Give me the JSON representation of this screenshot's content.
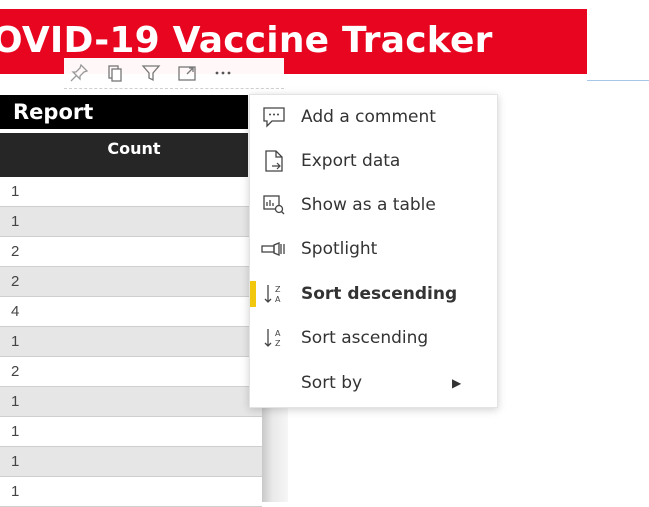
{
  "banner": {
    "title": "OVID-19 Vaccine Tracker"
  },
  "visual_header": {
    "icons": [
      "pin-icon",
      "copy-icon",
      "filter-icon",
      "focus-mode-icon",
      "more-options-icon"
    ]
  },
  "report": {
    "title": "Report",
    "column_header": "Count",
    "rows": [
      "1",
      "1",
      "2",
      "2",
      "4",
      "1",
      "2",
      "1",
      "1",
      "1",
      "1"
    ]
  },
  "context_menu": {
    "items": [
      {
        "label": "Add a comment",
        "icon": "comment-icon"
      },
      {
        "label": "Export data",
        "icon": "export-icon"
      },
      {
        "label": "Show as a table",
        "icon": "table-icon"
      },
      {
        "label": "Spotlight",
        "icon": "spotlight-icon"
      },
      {
        "label": "Sort descending",
        "icon": "sort-descending-icon",
        "active": true
      },
      {
        "label": "Sort ascending",
        "icon": "sort-ascending-icon"
      },
      {
        "label": "Sort by",
        "icon": "",
        "submenu": true
      }
    ]
  },
  "colors": {
    "banner": "#e8051f",
    "active_indicator": "#f2c80f",
    "header_bar": "#000000"
  }
}
